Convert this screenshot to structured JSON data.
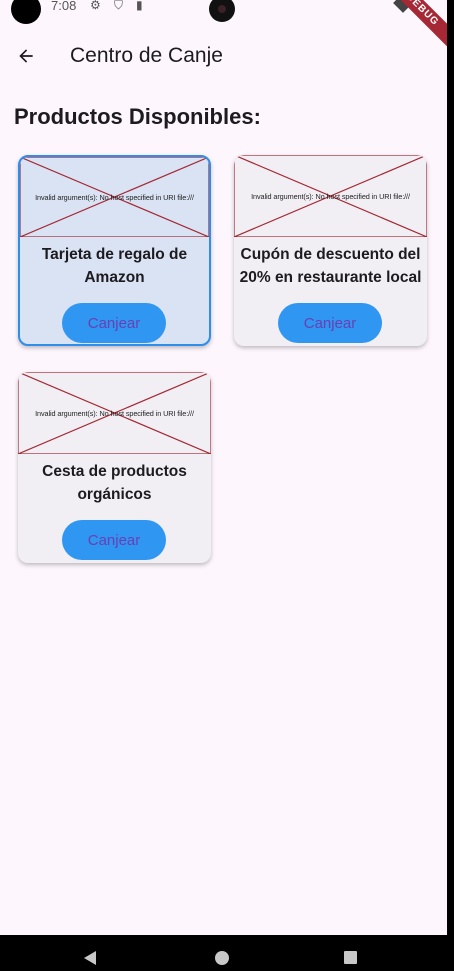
{
  "status_bar": {
    "time": "7:08",
    "icons": [
      "gear-icon",
      "shield-icon",
      "sim-card-icon",
      "wifi-icon"
    ],
    "debug_label": "DEBUG"
  },
  "app_bar": {
    "back_icon": "arrow-left-icon",
    "title": "Centro de Canje"
  },
  "section_title": "Productos Disponibles:",
  "products": [
    {
      "image_error": "Invalid argument(s): No host specified in URI file:///",
      "title": "Tarjeta de regalo de Amazon",
      "button_label": "Canjear",
      "selected": true
    },
    {
      "image_error": "Invalid argument(s): No host specified in URI file:///",
      "title": "Cupón de descuento del 20% en restaurante local",
      "button_label": "Canjear",
      "selected": false
    },
    {
      "image_error": "Invalid argument(s): No host specified in URI file:///",
      "title": "Cesta de productos orgánicos",
      "button_label": "Canjear",
      "selected": false
    }
  ],
  "colors": {
    "background": "#fdf7fd",
    "card": "#f1eff4",
    "card_selected": "#d9e3f3",
    "selected_border": "#2f8eea",
    "button": "#2f96f1",
    "button_text": "#6b3fb4",
    "placeholder_cross": "#a52834"
  },
  "nav_bar": {
    "icons": [
      "nav-back-icon",
      "nav-home-icon",
      "nav-recents-icon"
    ]
  }
}
